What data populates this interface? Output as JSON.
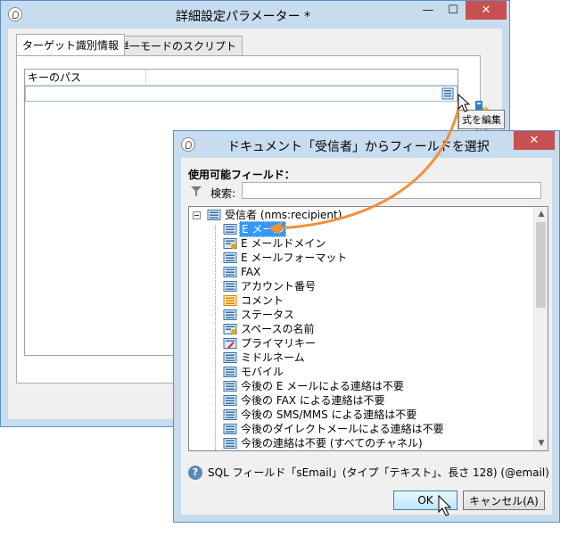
{
  "back_window": {
    "title": "詳細設定パラメーター *",
    "controls": {
      "minimize": "—",
      "maximize": "☐",
      "close": "✕"
    },
    "tabs": [
      {
        "label": "ターゲット識別情報",
        "active": true
      },
      {
        "label": "単一モードのスクリプト",
        "active": false
      }
    ],
    "grid": {
      "column_header": "キーのパス"
    },
    "tooltip": "式を編集"
  },
  "front_window": {
    "title": "ドキュメント「受信者」からフィールドを選択",
    "controls": {
      "close": "✕"
    },
    "available_fields_label": "使用可能フィールド：",
    "search_label": "検索:",
    "search_value": "",
    "tree": {
      "root": "受信者 (nms:recipient)",
      "items": [
        {
          "label": "E メール",
          "icon": "field-icon",
          "selected": true
        },
        {
          "label": "E メールドメイン",
          "icon": "computed-field-icon",
          "selected": false
        },
        {
          "label": "E メールフォーマット",
          "icon": "field-icon",
          "selected": false
        },
        {
          "label": "FAX",
          "icon": "field-icon",
          "selected": false
        },
        {
          "label": "アカウント番号",
          "icon": "field-icon",
          "selected": false
        },
        {
          "label": "コメント",
          "icon": "memo-field-icon",
          "selected": false
        },
        {
          "label": "ステータス",
          "icon": "field-icon",
          "selected": false
        },
        {
          "label": "スペースの名前",
          "icon": "computed-field-icon",
          "selected": false
        },
        {
          "label": "プライマリキー",
          "icon": "key-field-icon",
          "selected": false
        },
        {
          "label": "ミドルネーム",
          "icon": "field-icon",
          "selected": false
        },
        {
          "label": "モバイル",
          "icon": "field-icon",
          "selected": false
        },
        {
          "label": "今後の E メールによる連絡は不要",
          "icon": "field-icon",
          "selected": false
        },
        {
          "label": "今後の FAX による連絡は不要",
          "icon": "field-icon",
          "selected": false
        },
        {
          "label": "今後の SMS/MMS による連絡は不要",
          "icon": "field-icon",
          "selected": false
        },
        {
          "label": "今後のダイレクトメールによる連絡は不要",
          "icon": "field-icon",
          "selected": false
        },
        {
          "label": "今後の連絡は不要 (すべてのチャネル)",
          "icon": "field-icon",
          "selected": false
        }
      ]
    },
    "status_text": "SQL フィールド「sEmail」(タイプ「テキスト」、長さ 128) (@email)",
    "ok_label": "OK",
    "cancel_label": "キャンセル(A)"
  },
  "colors": {
    "accent": "#3399ff",
    "arrow": "#f0913a",
    "close": "#c75050"
  }
}
